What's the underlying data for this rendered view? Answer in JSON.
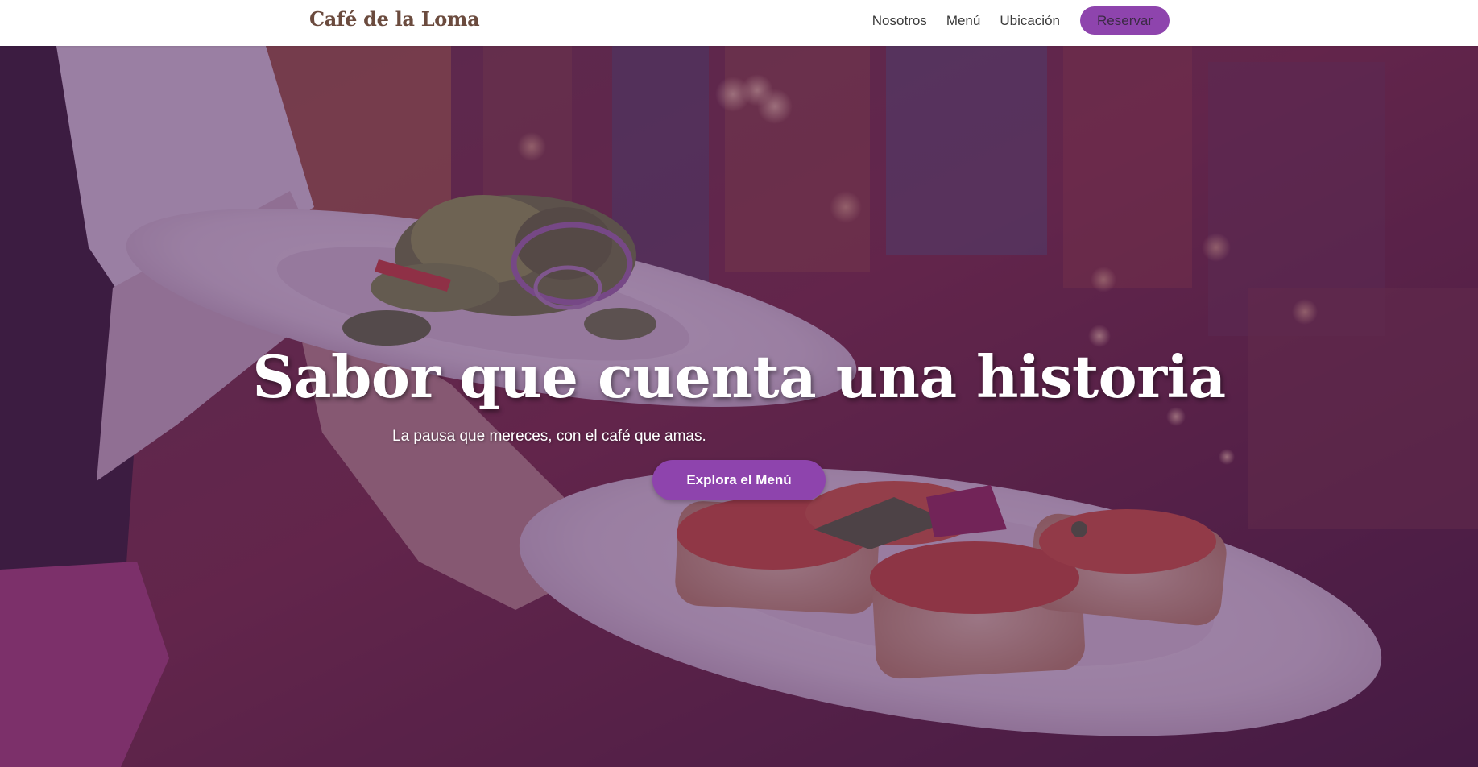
{
  "header": {
    "brand": "Café de la Loma",
    "nav": [
      {
        "label": "Nosotros"
      },
      {
        "label": "Menú"
      },
      {
        "label": "Ubicación"
      }
    ],
    "reserve_label": "Reservar"
  },
  "hero": {
    "title": "Sabor que cuenta una historia",
    "subtitle": "La pausa que mereces, con el café que amas.",
    "cta_label": "Explora el Menú",
    "overlay_color": "#4c1d5c"
  },
  "colors": {
    "accent": "#8e44ad",
    "brand_text": "#6b4b3e",
    "header_bg": "#ffffff"
  }
}
